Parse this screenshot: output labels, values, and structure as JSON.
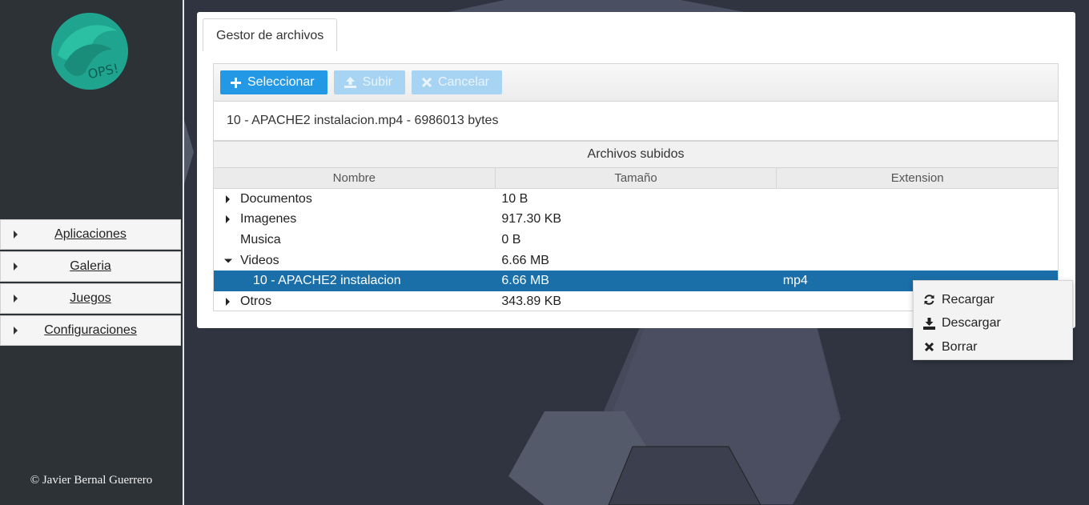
{
  "sidebar": {
    "logo_text": "OPS!",
    "menu": [
      {
        "label": "Aplicaciones"
      },
      {
        "label": "Galeria"
      },
      {
        "label": "Juegos"
      },
      {
        "label": "Configuraciones"
      }
    ],
    "copyright": "© Javier Bernal Guerrero"
  },
  "panel": {
    "tab_label": "Gestor de archivos",
    "toolbar": {
      "select_label": "Seleccionar",
      "upload_label": "Subir",
      "cancel_label": "Cancelar"
    },
    "selected_file": "10 - APACHE2 instalacion.mp4 - 6986013 bytes",
    "tree": {
      "caption": "Archivos subidos",
      "columns": [
        "Nombre",
        "Tamaño",
        "Extension"
      ],
      "rows": [
        {
          "name": "Documentos",
          "size": "10 B",
          "ext": ""
        },
        {
          "name": "Imagenes",
          "size": "917.30 KB",
          "ext": ""
        },
        {
          "name": "Musica",
          "size": "0 B",
          "ext": ""
        },
        {
          "name": "Videos",
          "size": "6.66 MB",
          "ext": ""
        },
        {
          "name": "10 - APACHE2 instalacion",
          "size": "6.66 MB",
          "ext": "mp4"
        },
        {
          "name": "Otros",
          "size": "343.89 KB",
          "ext": ""
        }
      ]
    }
  },
  "context_menu": {
    "items": [
      {
        "label": "Recargar",
        "icon": "refresh-icon"
      },
      {
        "label": "Descargar",
        "icon": "download-icon"
      },
      {
        "label": "Borrar",
        "icon": "close-icon"
      }
    ]
  },
  "colors": {
    "accent": "#2399e5",
    "selected_row": "#1a6fa8",
    "background": "#2f3440",
    "sidebar": "#2d3237"
  }
}
